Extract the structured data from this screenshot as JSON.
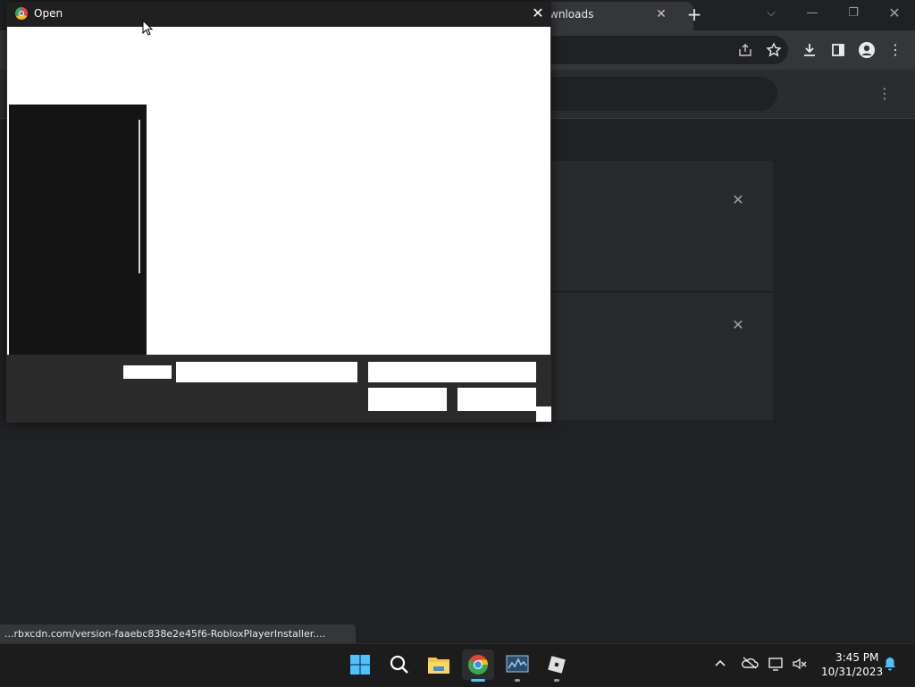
{
  "browser": {
    "tab": {
      "title": "wnloads",
      "close_glyph": "✕"
    },
    "new_tab_glyph": "+",
    "window_controls": {
      "tab_search": "⌵",
      "minimize": "—",
      "restore": "❐",
      "close": "✕"
    },
    "toolbar_icons": [
      "share-icon",
      "bookmark-star-icon",
      "download-icon",
      "side-panel-icon",
      "profile-icon",
      "menu-icon"
    ],
    "status_url": "...rbxcdn.com/version-faaebc838e2e45f6-RobloxPlayerInstaller...."
  },
  "downloads_page": {
    "menu_glyph": "⋮",
    "card_close_glyph": "✕"
  },
  "dialog": {
    "title": "Open",
    "close_glyph": "✕",
    "state": "partially-rendered"
  },
  "taskbar": {
    "apps": [
      "start",
      "search",
      "file-explorer",
      "chrome",
      "task-manager",
      "roblox"
    ],
    "active_app": "chrome",
    "clock": {
      "time": "3:45 PM",
      "date": "10/31/2023"
    },
    "tray_icons": [
      "show-hidden-icons",
      "onedrive-icon",
      "network-icon",
      "volume-muted-icon",
      "notification-bell-icon"
    ]
  },
  "colors": {
    "page_bg": "#202124",
    "toolbar": "#35363a",
    "taskbar": "#1c1c1c",
    "accent": "#4cc2ff"
  }
}
